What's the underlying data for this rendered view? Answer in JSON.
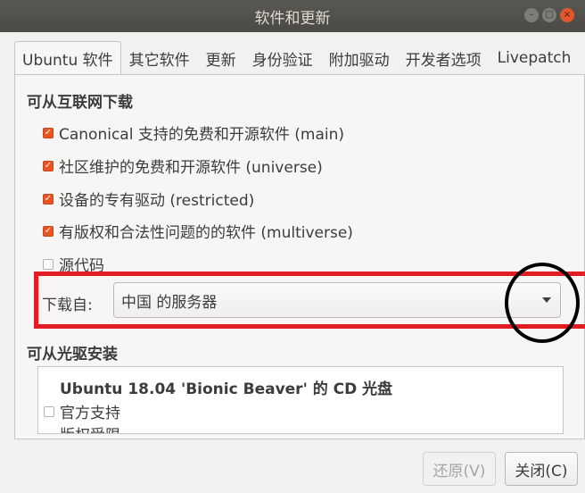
{
  "window": {
    "title": "软件和更新",
    "controls": {
      "minimize": "–",
      "maximize": "□",
      "close": "×"
    }
  },
  "tabs": [
    {
      "label": "Ubuntu 软件",
      "active": true
    },
    {
      "label": "其它软件",
      "active": false
    },
    {
      "label": "更新",
      "active": false
    },
    {
      "label": "身份验证",
      "active": false
    },
    {
      "label": "附加驱动",
      "active": false
    },
    {
      "label": "开发者选项",
      "active": false
    },
    {
      "label": "Livepatch",
      "active": false
    }
  ],
  "internet": {
    "title": "可从互联网下载",
    "items": [
      {
        "label": "Canonical 支持的免费和开源软件 (main)",
        "checked": true
      },
      {
        "label": "社区维护的免费和开源软件 (universe)",
        "checked": true
      },
      {
        "label": "设备的专有驱动 (restricted)",
        "checked": true
      },
      {
        "label": "有版权和合法性问题的的软件 (multiverse)",
        "checked": true
      },
      {
        "label": "源代码",
        "checked": false
      }
    ]
  },
  "download": {
    "label": "下载自:",
    "selected": "中国 的服务器"
  },
  "cdrom": {
    "title": "可从光驱安装",
    "disc_name": "Ubuntu 18.04 'Bionic Beaver' 的 CD 光盘",
    "items": [
      {
        "label": "官方支持",
        "checked": false
      },
      {
        "label": "版权受限",
        "checked": false
      }
    ]
  },
  "buttons": {
    "revert": "还原(V)",
    "close": "关闭(C)"
  },
  "colors": {
    "accent": "#e95420",
    "highlight_box": "#e31b23",
    "annotation_circle": "#000000"
  }
}
